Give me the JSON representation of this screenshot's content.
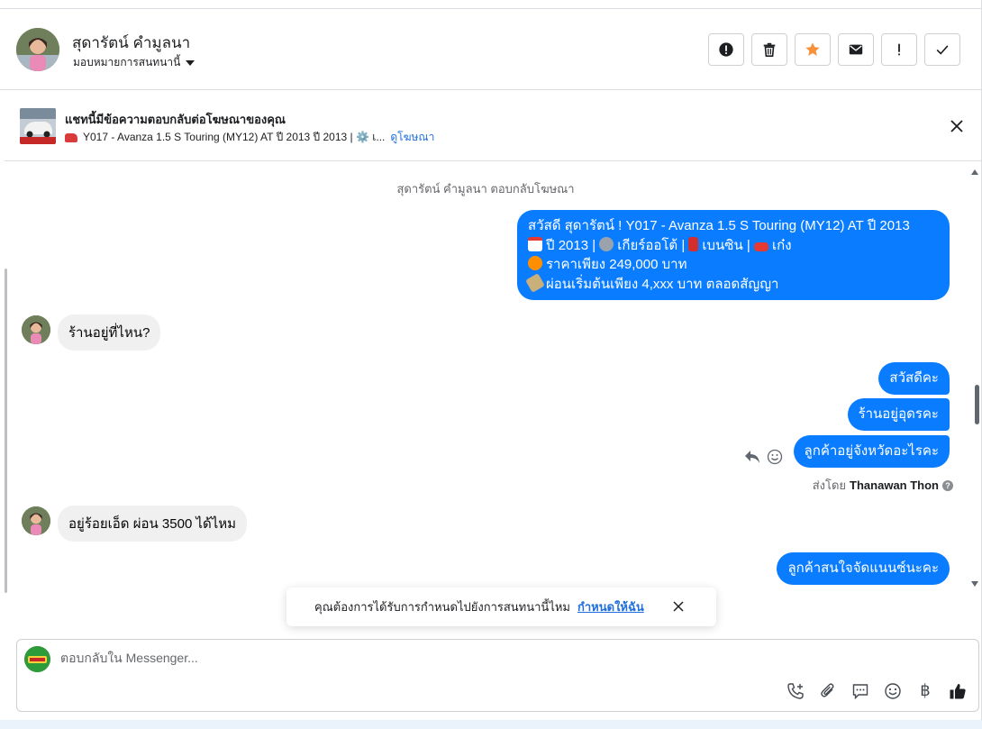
{
  "contact": {
    "name": "สุดารัตน์ คำมูลนา",
    "assign_label": "มอบหมายการสนทนานี้"
  },
  "actions": [
    {
      "name": "report-icon"
    },
    {
      "name": "trash-icon"
    },
    {
      "name": "star-icon",
      "color": "#f7923b"
    },
    {
      "name": "envelope-icon"
    },
    {
      "name": "exclamation-icon",
      "label": "!"
    },
    {
      "name": "check-icon"
    }
  ],
  "ad_banner": {
    "title": "แชทนี้มีข้อความตอบกลับต่อโฆษณาของคุณ",
    "subtitle": "Y017 - Avanza 1.5 S Touring (MY12) AT ปี 2013 ปี 2013 | ⚙️ เ...",
    "link": "ดูโฆษณา"
  },
  "chat": {
    "system_note": "สุดารัตน์ คำมูลนา ตอบกลับโฆษณา",
    "ad_reply": {
      "line1": "สวัสดี สุดารัตน์ ! Y017 - Avanza 1.5 S Touring (MY12) AT ปี 2013",
      "line2_a": "ปี 2013 |",
      "line2_b": "เกียร์ออโต้ |",
      "line2_c": "เบนซิน |",
      "line2_d": "เก๋ง",
      "line3": "ราคาเพียง 249,000 บาท",
      "line4": "ผ่อนเริ่มต้นเพียง 4,xxx บาท ตลอดสัญญา"
    },
    "incoming_1": "ร้านอยู่ที่ไหน?",
    "outgoing_1": "สวัสดีคะ",
    "outgoing_2": "ร้านอยู่อุดรคะ",
    "outgoing_3": "ลูกค้าอยู่จังหวัดอะไรคะ",
    "sent_by_prefix": "ส่งโดย",
    "sent_by_name": "Thanawan Thon",
    "incoming_2": "อยู่ร้อยเอ็ด ผ่อน 3500 ได้ไหม",
    "outgoing_4": "ลูกค้าสนใจจัดแนนซ์นะคะ"
  },
  "toast": {
    "text": "คุณต้องการได้รับการกำหนดไปยังการสนทนานี้ไหม",
    "link": "กำหนดให้ฉัน"
  },
  "composer": {
    "placeholder": "ตอบกลับใน Messenger...",
    "baht_symbol": "฿",
    "accent": "#1c1e21"
  },
  "colors": {
    "outgoing_bubble": "#0a7cff",
    "incoming_bubble": "#f0f0f0",
    "link": "#216fdb"
  }
}
